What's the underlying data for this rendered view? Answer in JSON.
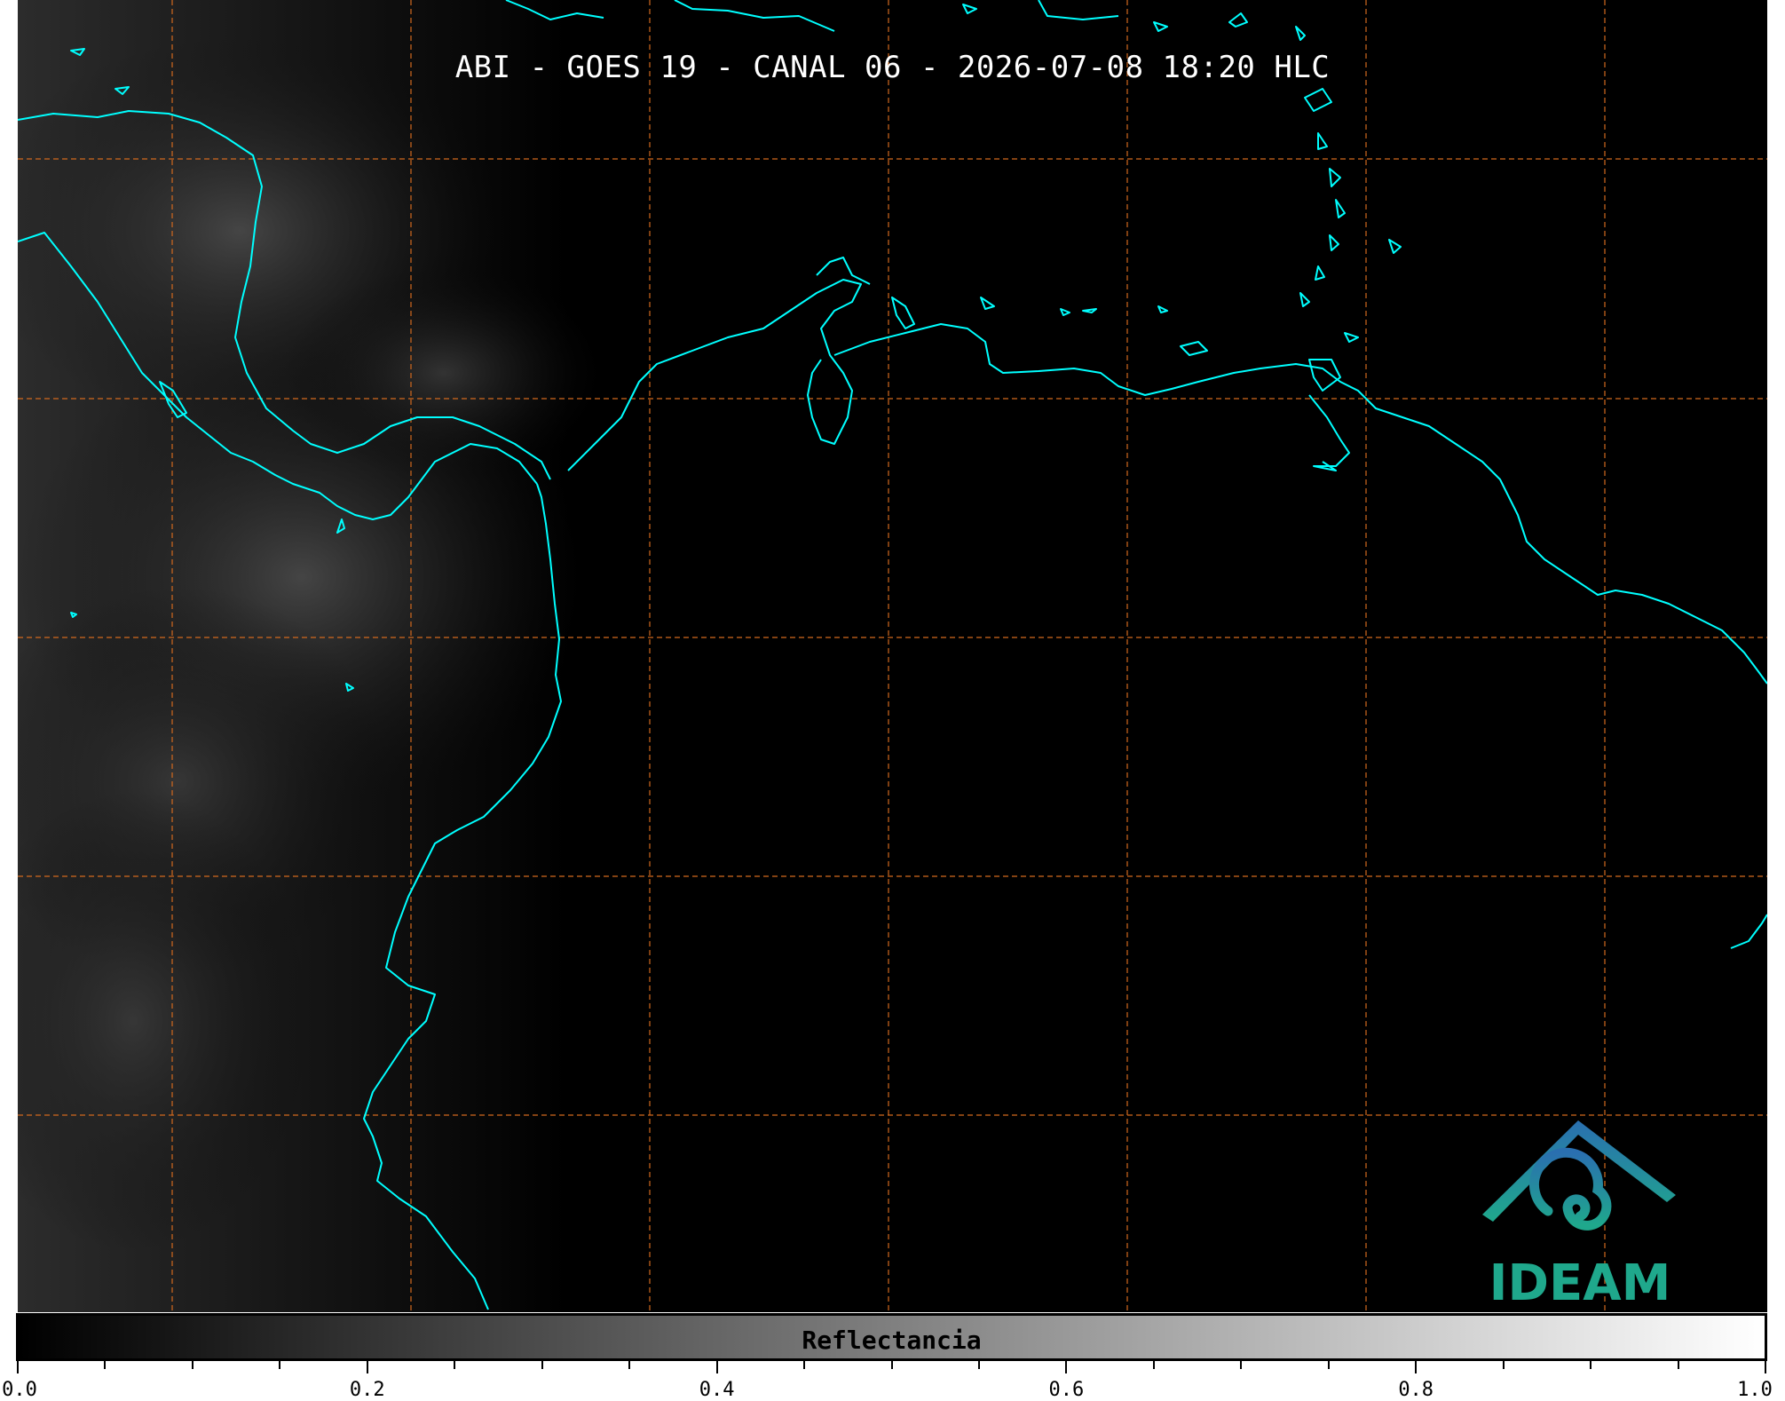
{
  "title": "ABI - GOES 19 - CANAL 06 - 2026-07-08 18:20 HLC",
  "logo": {
    "text": "IDEAM"
  },
  "colorbar": {
    "label": "Reflectancia",
    "range": [
      0.0,
      1.0
    ],
    "colormap": "grayscale black-to-white",
    "major_ticks": [
      "0.0",
      "0.2",
      "0.4",
      "0.6",
      "0.8",
      "1.0"
    ],
    "minor_step": 0.05
  },
  "colors": {
    "coastline": "#00ffff",
    "graticule": "#d2691e",
    "background": "#000000",
    "logo_blue": "#2a6fb0",
    "logo_green": "#1fa88c"
  }
}
